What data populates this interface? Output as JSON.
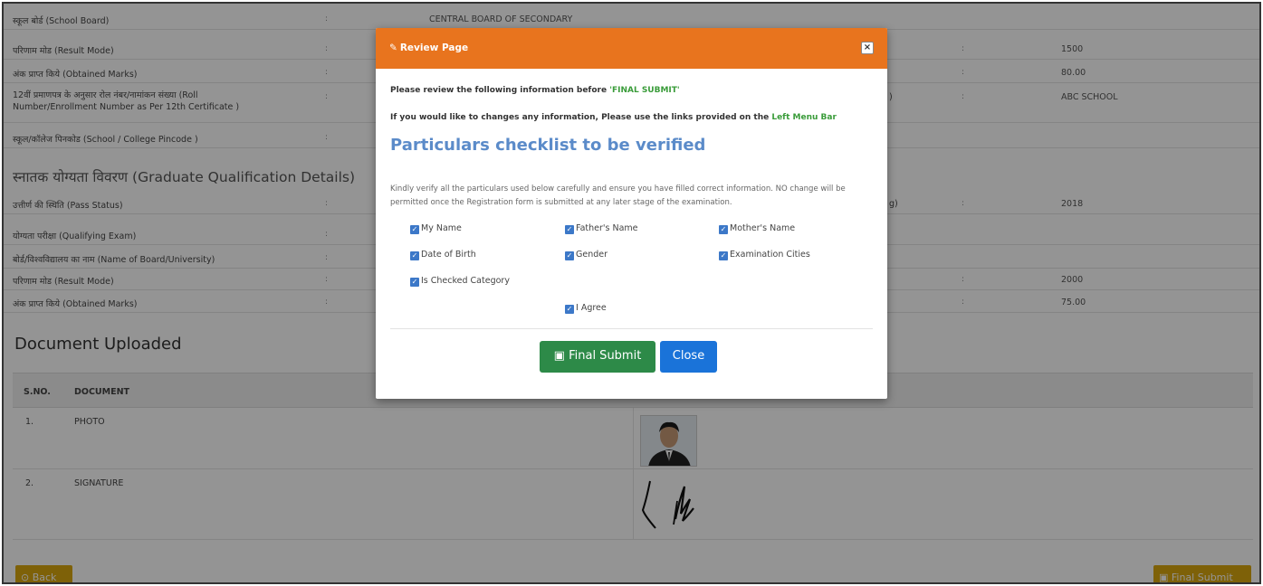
{
  "background": {
    "rows": [
      {
        "label": "स्कूल बोर्ड (School Board)",
        "sep": ":",
        "value": "CENTRAL BOARD OF SECONDARY",
        "sep2": "",
        "value2": "",
        "mid": ""
      },
      {
        "label": "परिणाम मोड (Result Mode)",
        "sep": ":",
        "value": "",
        "sep2": ":",
        "value2": "1500",
        "mid": ""
      },
      {
        "label": "अंक प्राप्त किये (Obtained Marks)",
        "sep": ":",
        "value": "",
        "sep2": ":",
        "value2": "80.00",
        "mid": ""
      },
      {
        "label1": "12वीं प्रमाणपत्र के अनुसार रोल नंबर/नामांकन संख्या (Roll",
        "label2": "Number/Enrollment Number as Per 12th Certificate )",
        "sep": ":",
        "value": "",
        "sep2": ":",
        "value2": "ABC SCHOOL",
        "mid": ")"
      },
      {
        "label": "स्कूल/कॉलेज पिनकोड (School / College Pincode )",
        "sep": ":",
        "value": "",
        "sep2": "",
        "value2": "",
        "mid": ""
      }
    ],
    "graduate_section_title": "स्नातक योग्यता विवरण (Graduate Qualification Details)",
    "grad_rows": [
      {
        "label": "उत्तीर्ण की स्थिति (Pass Status)",
        "sep": ":",
        "value": "",
        "sep2": ":",
        "value2": "2018",
        "mid": "g)"
      },
      {
        "label": "योग्यता परीक्षा (Qualifying Exam)",
        "sep": ":",
        "value": "",
        "sep2": "",
        "value2": "",
        "mid": ""
      },
      {
        "label": "बोर्ड/विश्वविद्यालय का नाम (Name of Board/University)",
        "sep": ":",
        "value": "",
        "sep2": "",
        "value2": "",
        "mid": ""
      },
      {
        "label": "परिणाम मोड (Result Mode)",
        "sep": ":",
        "value": "",
        "sep2": ":",
        "value2": "2000",
        "mid": ""
      },
      {
        "label": "अंक प्राप्त किये (Obtained Marks)",
        "sep": ":",
        "value": "",
        "sep2": ":",
        "value2": "75.00",
        "mid": ""
      }
    ],
    "documents_title": "Document Uploaded",
    "doc_headers": {
      "sno": "S.NO.",
      "document": "DOCUMENT"
    },
    "documents": [
      {
        "sno": "1.",
        "name": "PHOTO"
      },
      {
        "sno": "2.",
        "name": "SIGNATURE"
      }
    ],
    "back_label": "⊙ Back",
    "final_submit_label": "▣ Final Submit"
  },
  "modal": {
    "title": "Review Page",
    "close_symbol": "×",
    "line1_prefix": "Please review the following information before ",
    "line1_highlight": "'FINAL SUBMIT'",
    "line2_prefix": "If you would like to changes any information, Please use the links provided on the ",
    "line2_highlight": "Left Menu Bar",
    "checklist_title": "Particulars checklist to be verified",
    "note": "Kindly verify all the particulars used below carefully and ensure you have filled correct information. NO change will be permitted once the Registration form is submitted at any later stage of the examination.",
    "checkboxes": [
      {
        "label": "My Name",
        "checked": true
      },
      {
        "label": "Father's Name",
        "checked": true
      },
      {
        "label": "Mother's Name",
        "checked": true
      },
      {
        "label": "Date of Birth",
        "checked": true
      },
      {
        "label": "Gender",
        "checked": true
      },
      {
        "label": "Examination Cities",
        "checked": true
      },
      {
        "label": "Is Checked Category",
        "checked": true
      },
      {
        "label": "I Agree",
        "checked": true
      }
    ],
    "submit_label": "Final Submit",
    "close_label": "Close"
  },
  "colors": {
    "header": "#e8741e",
    "submit": "#2d8a48",
    "close": "#1a73d9",
    "highlight": "#3a9c3a",
    "checklist_title": "#5b8bc9",
    "bg_button": "#d9a70f"
  }
}
